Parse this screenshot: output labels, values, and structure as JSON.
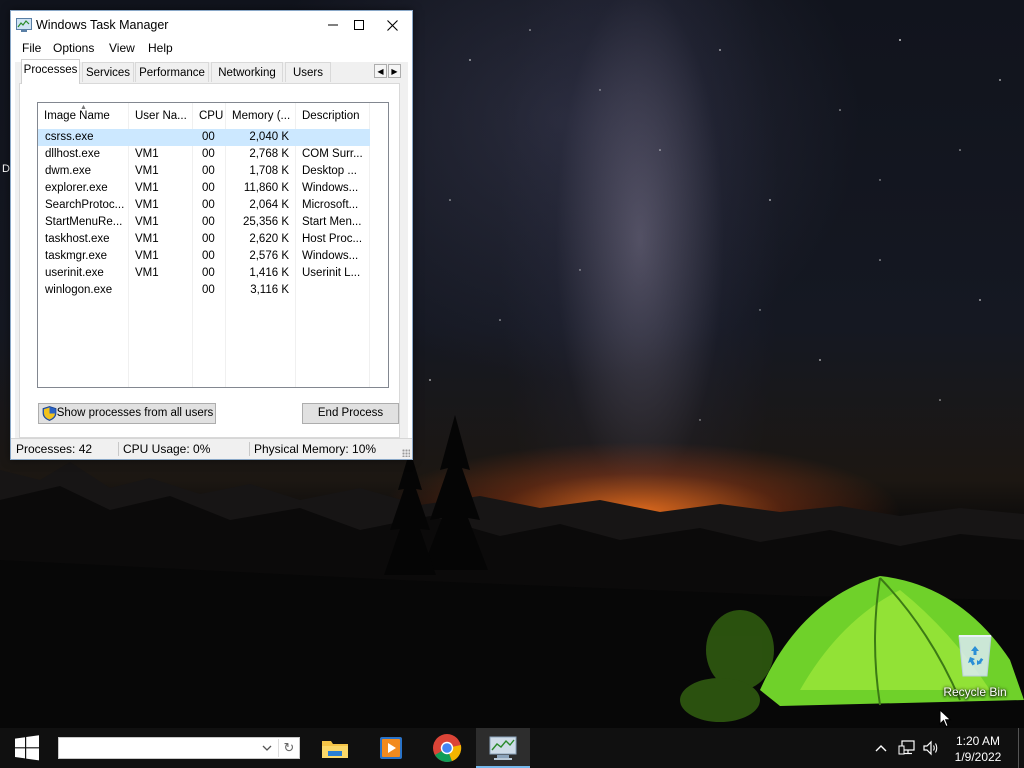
{
  "window": {
    "title": "Windows Task Manager",
    "minimize_label": "minimize",
    "maximize_label": "maximize",
    "close_label": "close"
  },
  "menu": [
    "File",
    "Options",
    "View",
    "Help"
  ],
  "tabs": [
    "Processes",
    "Services",
    "Performance",
    "Networking",
    "Users"
  ],
  "active_tab": "Processes",
  "columns": [
    "Image Name",
    "User Na...",
    "CPU",
    "Memory (...",
    "Description"
  ],
  "processes": [
    {
      "name": "csrss.exe",
      "user": "",
      "cpu": "00",
      "memory": "2,040 K",
      "description": "",
      "selected": true
    },
    {
      "name": "dllhost.exe",
      "user": "VM1",
      "cpu": "00",
      "memory": "2,768 K",
      "description": "COM Surr..."
    },
    {
      "name": "dwm.exe",
      "user": "VM1",
      "cpu": "00",
      "memory": "1,708 K",
      "description": "Desktop ..."
    },
    {
      "name": "explorer.exe",
      "user": "VM1",
      "cpu": "00",
      "memory": "11,860 K",
      "description": "Windows..."
    },
    {
      "name": "SearchProtoc...",
      "user": "VM1",
      "cpu": "00",
      "memory": "2,064 K",
      "description": "Microsoft..."
    },
    {
      "name": "StartMenuRe...",
      "user": "VM1",
      "cpu": "00",
      "memory": "25,356 K",
      "description": "Start Men..."
    },
    {
      "name": "taskhost.exe",
      "user": "VM1",
      "cpu": "00",
      "memory": "2,620 K",
      "description": "Host Proc..."
    },
    {
      "name": "taskmgr.exe",
      "user": "VM1",
      "cpu": "00",
      "memory": "2,576 K",
      "description": "Windows..."
    },
    {
      "name": "userinit.exe",
      "user": "VM1",
      "cpu": "00",
      "memory": "1,416 K",
      "description": "Userinit L..."
    },
    {
      "name": "winlogon.exe",
      "user": "",
      "cpu": "00",
      "memory": "3,116 K",
      "description": ""
    }
  ],
  "buttons": {
    "show_all": "Show processes from all users",
    "end_process": "End Process"
  },
  "status": {
    "processes": "Processes: 42",
    "cpu": "CPU Usage: 0%",
    "memory": "Physical Memory: 10%"
  },
  "desktop": {
    "edge_letter": "D",
    "recycle_bin": "Recycle Bin"
  },
  "taskbar": {
    "apps": [
      "file-explorer-icon",
      "media-player-icon",
      "chrome-icon",
      "task-manager-icon"
    ],
    "active_app": "task-manager-icon",
    "time": "1:20 AM",
    "date": "1/9/2022"
  },
  "colors": {
    "selection": "#cce8ff",
    "taskbar": "#101010",
    "taskbar_active_indicator": "#76b9ed"
  }
}
